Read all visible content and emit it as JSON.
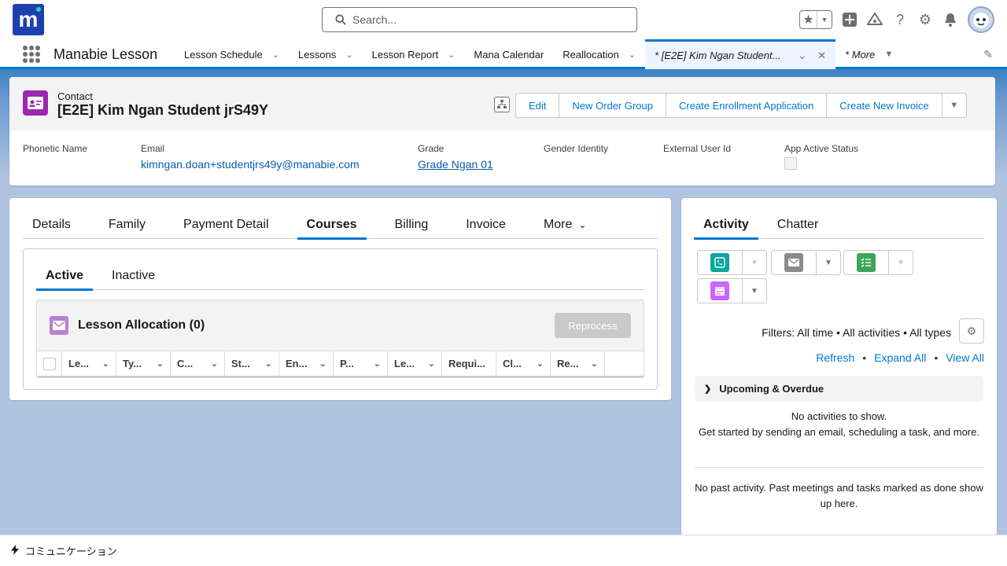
{
  "header": {
    "logo_letter": "m",
    "search_placeholder": "Search..."
  },
  "nav": {
    "app_name": "Manabie Lesson",
    "items": [
      {
        "label": "Lesson Schedule",
        "has_menu": true
      },
      {
        "label": "Lessons",
        "has_menu": true
      },
      {
        "label": "Lesson Report",
        "has_menu": true
      },
      {
        "label": "Mana Calendar",
        "has_menu": false
      },
      {
        "label": "Reallocation",
        "has_menu": true
      }
    ],
    "active_tab": "* [E2E] Kim Ngan Student...",
    "more": "* More"
  },
  "record": {
    "object_label": "Contact",
    "title": "[E2E] Kim Ngan Student jrS49Y",
    "buttons": [
      "Edit",
      "New Order Group",
      "Create Enrollment Application",
      "Create New Invoice"
    ],
    "fields": {
      "phonetic_name": {
        "label": "Phonetic Name",
        "value": ""
      },
      "email": {
        "label": "Email",
        "value": "kimngan.doan+studentjrs49y@manabie.com"
      },
      "grade": {
        "label": "Grade",
        "value": "Grade Ngan 01"
      },
      "gender_identity": {
        "label": "Gender Identity",
        "value": ""
      },
      "external_user_id": {
        "label": "External User Id",
        "value": ""
      },
      "app_active_status": {
        "label": "App Active Status",
        "checked": false
      }
    }
  },
  "main": {
    "tabs": [
      "Details",
      "Family",
      "Payment Detail",
      "Courses",
      "Billing",
      "Invoice"
    ],
    "more_tab": "More",
    "active_tab": "Courses",
    "subtabs": [
      "Active",
      "Inactive"
    ],
    "active_subtab": "Active",
    "related_list": {
      "title": "Lesson Allocation (0)",
      "action": "Reprocess",
      "columns": [
        "Le...",
        "Ty...",
        "C...",
        "St...",
        "En...",
        "P...",
        "Le...",
        "Requi...",
        "Cl...",
        "Re..."
      ]
    }
  },
  "activity": {
    "tabs": [
      "Activity",
      "Chatter"
    ],
    "active_tab": "Activity",
    "filters": "Filters: All time • All activities • All types",
    "links": {
      "refresh": "Refresh",
      "expand": "Expand All",
      "view": "View All",
      "separator": "•"
    },
    "upcoming_label": "Upcoming & Overdue",
    "no_activities": "No activities to show.",
    "get_started": "Get started by sending an email, scheduling a task, and more.",
    "no_past": "No past activity. Past meetings and tasks marked as done show up here."
  },
  "utility_bar": {
    "label": "コミュニケーション"
  },
  "colors": {
    "brand": "#0176d3",
    "logo_bg": "#1e40af",
    "contact_icon": "#9c27b0",
    "call_icon": "#0ba599",
    "email_icon": "#8a8a8a",
    "task_icon": "#3ba755",
    "event_icon": "#cb65ff"
  }
}
